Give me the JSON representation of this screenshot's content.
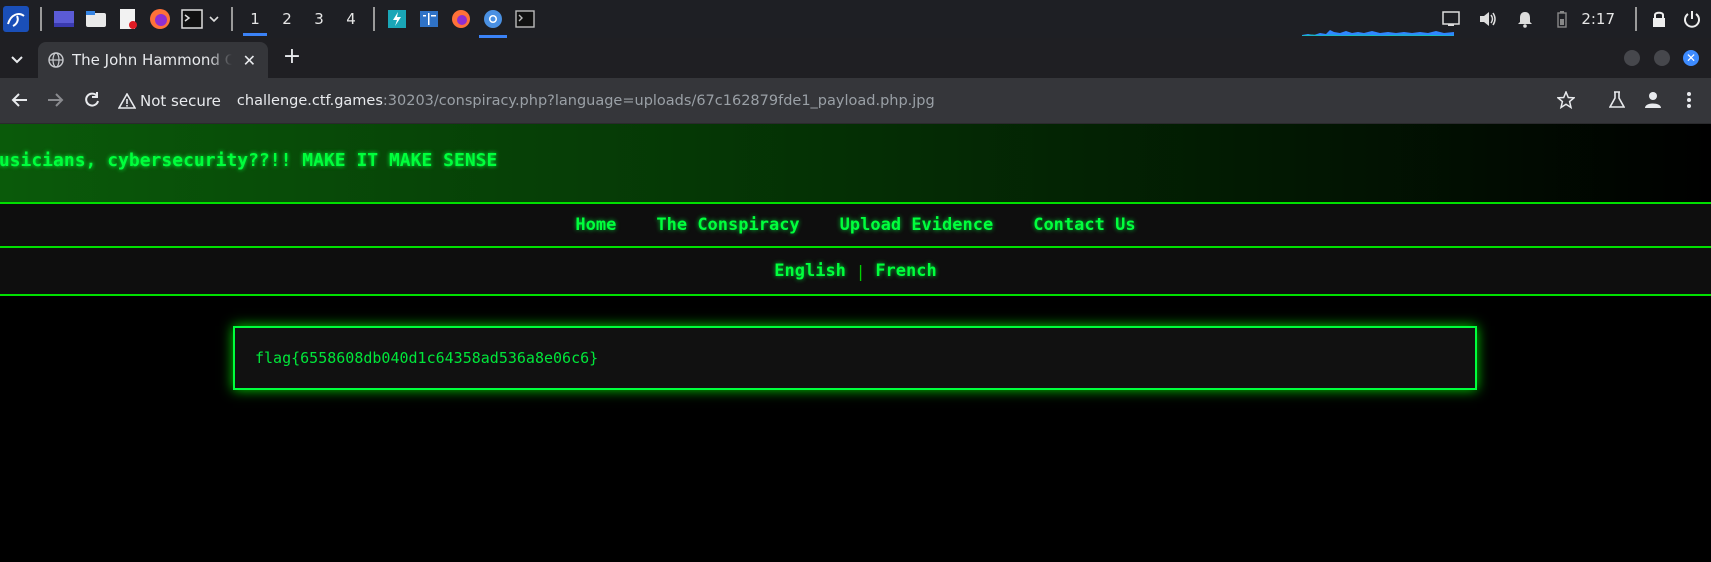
{
  "taskbar": {
    "workspaces": [
      "1",
      "2",
      "3",
      "4"
    ],
    "active_workspace": "1",
    "clock": "2:17",
    "icons": [
      "kali-menu-icon",
      "show-desktop-icon",
      "file-manager-icon",
      "text-editor-icon",
      "firefox-icon",
      "terminal-icon",
      "chevron-down-icon"
    ]
  },
  "browser": {
    "tab_title": "The John Hammond Conspiracy",
    "new_tab_label": "+",
    "security_label": "Not secure",
    "url_host": "challenge.ctf.games",
    "url_rest": ":30203/conspiracy.php?language=uploads/67c162879fde1_payload.php.jpg"
  },
  "page": {
    "banner_text": "musicians, cybersecurity??!! MAKE IT MAKE SENSE",
    "nav": [
      "Home",
      "The Conspiracy",
      "Upload Evidence",
      "Contact Us"
    ],
    "languages": [
      "English",
      "French"
    ],
    "language_separator": "|",
    "flag": "flag{6558608db040d1c64358ad536a8e06c6}"
  },
  "colors": {
    "accent_green": "#00ff3c",
    "taskbar_bg": "#1e1f24",
    "toolbar_bg": "#35363a",
    "active_indicator": "#3b82f6"
  }
}
